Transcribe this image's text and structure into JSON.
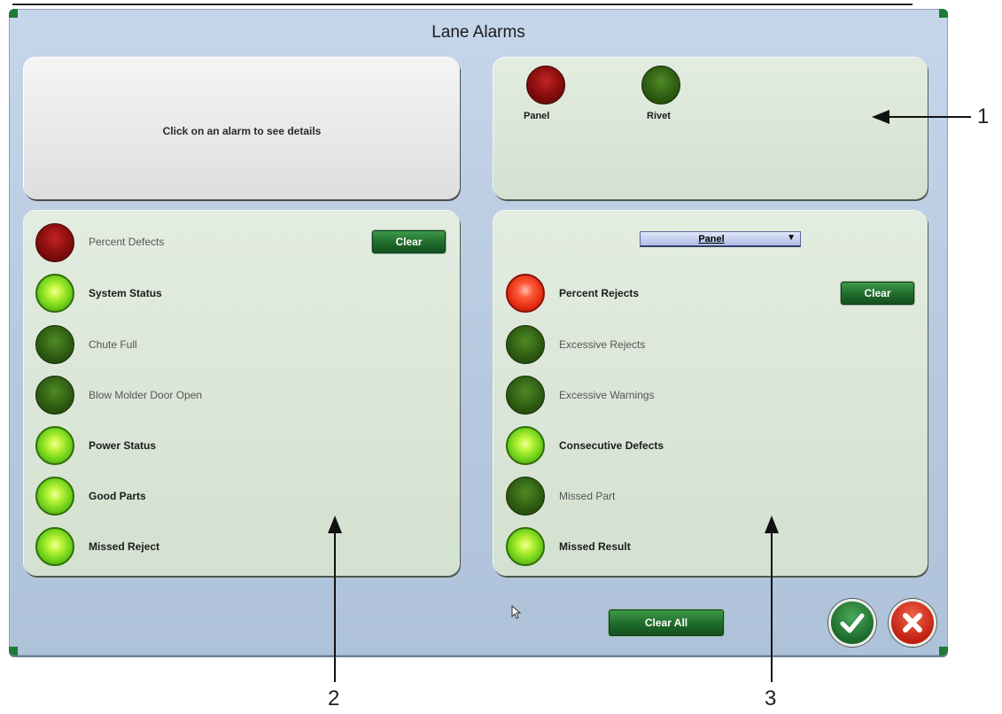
{
  "window": {
    "title": "Lane Alarms"
  },
  "detail": {
    "text": "Click on an alarm to see details"
  },
  "lanes": [
    {
      "label": "Panel",
      "state": "dark-red"
    },
    {
      "label": "Rivet",
      "state": "dark-green"
    }
  ],
  "left_alarms": [
    {
      "label": "Percent Defects",
      "state": "dark-red",
      "active": false
    },
    {
      "label": "System Status",
      "state": "bright-green",
      "active": true
    },
    {
      "label": "Chute Full",
      "state": "dark-green",
      "active": false
    },
    {
      "label": "Blow Molder Door Open",
      "state": "dark-green",
      "active": false
    },
    {
      "label": "Power Status",
      "state": "bright-green",
      "active": true
    },
    {
      "label": "Good Parts",
      "state": "bright-green",
      "active": true
    },
    {
      "label": "Missed Reject",
      "state": "bright-green",
      "active": true
    }
  ],
  "right_alarms": [
    {
      "label": "Percent Rejects",
      "state": "bright-red",
      "active": true
    },
    {
      "label": "Excessive Rejects",
      "state": "dark-green",
      "active": false
    },
    {
      "label": "Excessive Warnings",
      "state": "dark-green",
      "active": false
    },
    {
      "label": "Consecutive Defects",
      "state": "bright-green",
      "active": true
    },
    {
      "label": "Missed Part",
      "state": "dark-green",
      "active": false
    },
    {
      "label": "Missed Result",
      "state": "bright-green",
      "active": true
    }
  ],
  "lane_selector": {
    "value": "Panel"
  },
  "buttons": {
    "clear": "Clear",
    "clear_all": "Clear All"
  },
  "callouts": {
    "one": "1",
    "two": "2",
    "three": "3"
  },
  "colors": {
    "dialog_bg": "#b7c9e0",
    "panel_bg": "#d3e1d0",
    "button_green": "#1f6a2a",
    "ok_green": "#1c6a2a",
    "cancel_red": "#c01f10"
  }
}
